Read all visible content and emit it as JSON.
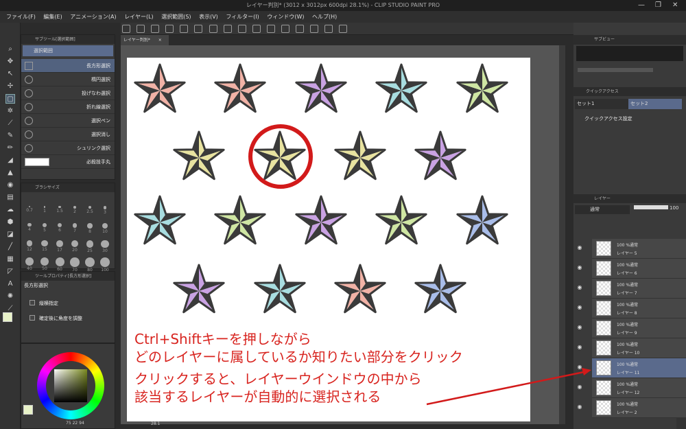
{
  "window": {
    "title": "レイヤー判別* (3012 x 3012px 600dpi 28.1%) - CLIP STUDIO PAINT PRO",
    "min": "—",
    "max": "❐",
    "close": "✕"
  },
  "menu": [
    "ファイル(F)",
    "編集(E)",
    "アニメーション(A)",
    "レイヤー(L)",
    "選択範囲(S)",
    "表示(V)",
    "フィルター(I)",
    "ウィンドウ(W)",
    "ヘルプ(H)"
  ],
  "sub_tool": {
    "header": "サブツール[選択範囲]",
    "group": "選択範囲",
    "items": [
      "長方形選択",
      "楕円選択",
      "投げなわ選択",
      "折れ線選択",
      "選択ペン",
      "選択消し",
      "シュリンク選択",
      "必殺技手丸"
    ]
  },
  "brush_size": {
    "header": "ブラシサイズ",
    "values": [
      "0.7",
      "1",
      "1.5",
      "2",
      "2.5",
      "3",
      "4",
      "5",
      "6",
      "7",
      "8",
      "10",
      "12",
      "15",
      "17",
      "20",
      "25",
      "30",
      "40",
      "50",
      "60",
      "70",
      "80",
      "100"
    ]
  },
  "tool_property": {
    "header": "ツールプロパティ[長方形選択]",
    "title": "長方形選択",
    "opt1": "縦横指定",
    "opt2": "確定後に角度を調整"
  },
  "color": {
    "vals": [
      "75",
      "22",
      "94"
    ]
  },
  "doc_tab": {
    "label": "レイヤー判別*",
    "close": "×"
  },
  "status": {
    "zoom": "28.1"
  },
  "right": {
    "sub_view": "サブビュー",
    "quick_access": "クイックアクセス",
    "set1": "セット1",
    "set2": "セット2",
    "qa_setting": "クイックアクセス設定",
    "layer_tab": "レイヤー",
    "blend": "通常",
    "opacity": "100"
  },
  "layers": [
    {
      "mode": "100 %通常",
      "name": "レイヤー 5"
    },
    {
      "mode": "100 %通常",
      "name": "レイヤー 6"
    },
    {
      "mode": "100 %通常",
      "name": "レイヤー 7"
    },
    {
      "mode": "100 %通常",
      "name": "レイヤー 8"
    },
    {
      "mode": "100 %通常",
      "name": "レイヤー 9"
    },
    {
      "mode": "100 %通常",
      "name": "レイヤー 10"
    },
    {
      "mode": "100 %通常",
      "name": "レイヤー 11"
    },
    {
      "mode": "100 %通常",
      "name": "レイヤー 12"
    },
    {
      "mode": "100 %通常",
      "name": "レイヤー 2"
    }
  ],
  "annotation": {
    "line1": "Ctrl+Shiftキーを押しながら",
    "line2": "どのレイヤーに属しているか知りたい部分をクリック",
    "line3": "クリックすると、レイヤーウインドウの中から",
    "line4": "該当するレイヤーが自動的に選択される"
  },
  "colors": {
    "star_dark": "#3a3a3a",
    "highlight": "#d21a1a",
    "selected_layer": "#5a6a8c"
  },
  "stars": [
    {
      "color": "#f1b2a6"
    },
    {
      "color": "#f1b2a6"
    },
    {
      "color": "#c9a2e3"
    },
    {
      "color": "#a8dde0"
    },
    {
      "color": "#cfe6a3"
    },
    {
      "color": "#e8e3a0"
    },
    {
      "color": "#e8e3a0"
    },
    {
      "color": "#e8e3a0"
    },
    {
      "color": "#c9a2e3"
    },
    {
      "color": "#a8dde0"
    },
    {
      "color": "#cfe6a3"
    },
    {
      "color": "#c9a2e3"
    },
    {
      "color": "#cfe6a3"
    },
    {
      "color": "#a9bde9"
    },
    {
      "color": "#c9a2e3"
    },
    {
      "color": "#a8dde0"
    },
    {
      "color": "#f1b2a6"
    },
    {
      "color": "#a9bde9"
    }
  ]
}
